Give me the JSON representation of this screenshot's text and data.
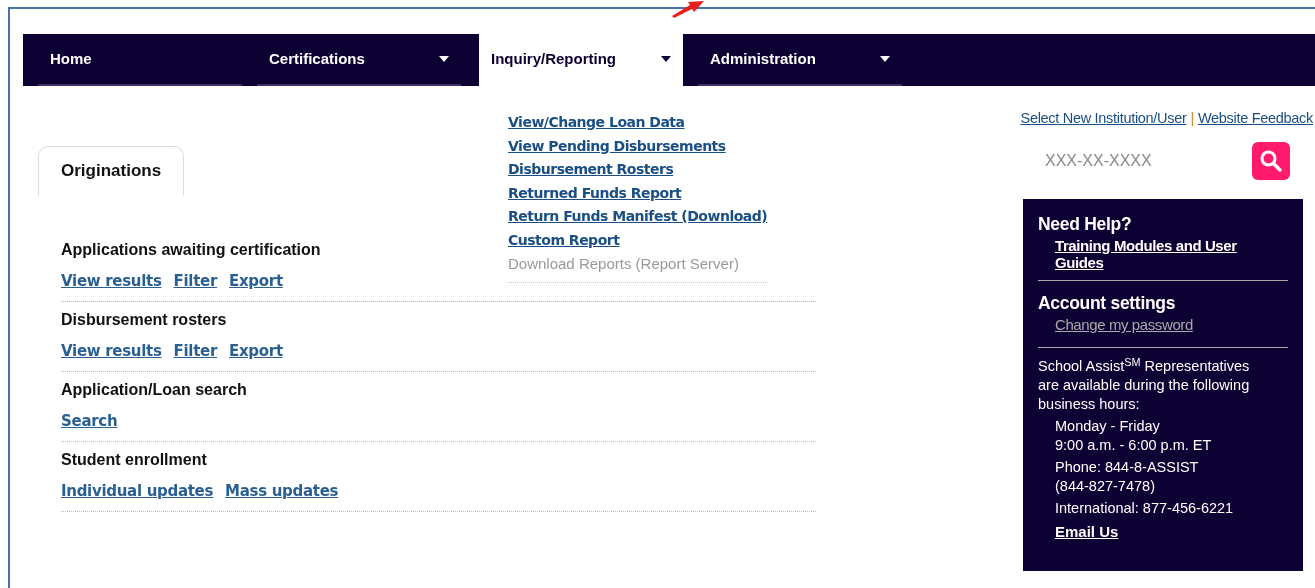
{
  "nav": {
    "tabs": [
      {
        "label": "Home",
        "kind": "link",
        "selected": false
      },
      {
        "label": "Certifications",
        "kind": "dropdown",
        "selected": false
      },
      {
        "label": "Inquiry/Reporting",
        "kind": "dropdown",
        "selected": true,
        "menu": [
          {
            "label": "View/Change Loan Data",
            "disabled": false
          },
          {
            "label": "View Pending Disbursements",
            "disabled": false
          },
          {
            "label": "Disbursement Rosters",
            "disabled": false
          },
          {
            "label": "Returned Funds Report",
            "disabled": false
          },
          {
            "label": "Return Funds Manifest (Download)",
            "disabled": false
          },
          {
            "label": "Custom Report",
            "disabled": false
          },
          {
            "label": "Download Reports (Report Server)",
            "disabled": true
          }
        ]
      },
      {
        "label": "Administration",
        "kind": "dropdown",
        "selected": false
      }
    ]
  },
  "content_tabs": [
    {
      "label": "Originations",
      "selected": true
    }
  ],
  "sections": [
    {
      "title": "Applications awaiting certification",
      "links": [
        "View results",
        "Filter",
        "Export"
      ]
    },
    {
      "title": "Disbursement rosters",
      "links": [
        "View results",
        "Filter",
        "Export"
      ]
    },
    {
      "title": "Application/Loan search",
      "links": [
        "Search"
      ]
    },
    {
      "title": "Student enrollment",
      "links": [
        "Individual updates",
        "Mass updates"
      ]
    }
  ],
  "top_links": [
    "Select New Institution/User",
    "|",
    "Website Feedback"
  ],
  "search": {
    "placeholder": "XXX-XX-XXXX"
  },
  "help_panel": {
    "sections": [
      {
        "title": "Need Help?",
        "links": [
          {
            "label": "Training Modules and User Guides",
            "disabled": false
          }
        ]
      },
      {
        "title": "Account settings",
        "links": [
          {
            "label": "Change my password",
            "disabled": true
          }
        ]
      }
    ],
    "intro": "School Assist$^{SM}$ Representatives are available during the following business hours:",
    "details": [
      [
        "Monday - Friday",
        "9:00 a.m. - 6:00 p.m. ET"
      ],
      [
        "Phone: 844-8-ASSIST",
        "(844-827-7478)"
      ],
      [
        "International: 877-456-6221"
      ]
    ],
    "email_link": "Email Us"
  }
}
